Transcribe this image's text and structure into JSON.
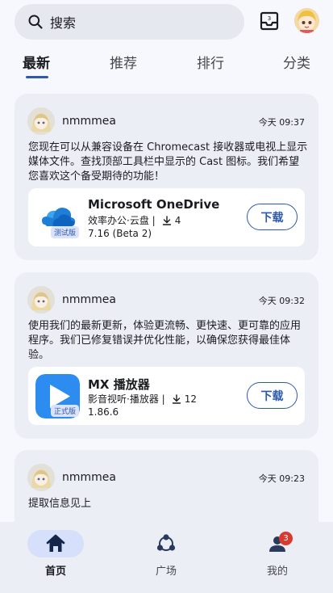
{
  "search": {
    "placeholder": "搜索"
  },
  "tabs": [
    {
      "label": "最新",
      "active": true
    },
    {
      "label": "推荐",
      "active": false
    },
    {
      "label": "排行",
      "active": false
    },
    {
      "label": "分类",
      "active": false
    }
  ],
  "posts": [
    {
      "user": "nmmmea",
      "time": "今天 09:37",
      "text": "您现在可以从兼容设备在 Chromecast 接收器或电视上显示媒体文件。查找顶部工具栏中显示的 Cast 图标。我们希望您喜欢这个备受期待的功能！",
      "app": {
        "name": "Microsoft OneDrive",
        "category": "效率办公·云盘 |",
        "downloads": "4",
        "version": "7.16 (Beta 2)",
        "badge": "测试版",
        "icon": "onedrive-icon",
        "button": "下载"
      }
    },
    {
      "user": "nmmmea",
      "time": "今天 09:32",
      "text": "使用我们的最新更新，体验更流畅、更快速、更可靠的应用程序。我们已修复错误并优化性能，以确保您获得最佳体验。",
      "app": {
        "name": "MX 播放器",
        "category": "影音视听·播放器 |",
        "downloads": "12",
        "version": "1.86.6",
        "badge": "正式版",
        "icon": "mx-player-icon",
        "button": "下载"
      }
    },
    {
      "user": "nmmmea",
      "time": "今天 09:23",
      "text": "提取信息见上"
    }
  ],
  "bottom_nav": [
    {
      "label": "首页",
      "icon": "home-icon",
      "active": true
    },
    {
      "label": "广场",
      "icon": "plaza-icon",
      "active": false
    },
    {
      "label": "我的",
      "icon": "profile-icon",
      "active": false,
      "badge": "3"
    }
  ],
  "colors": {
    "accent": "#2c5aa9",
    "surface": "#eceef6",
    "background": "#f7f8fd",
    "badge": "#d93a2f"
  }
}
